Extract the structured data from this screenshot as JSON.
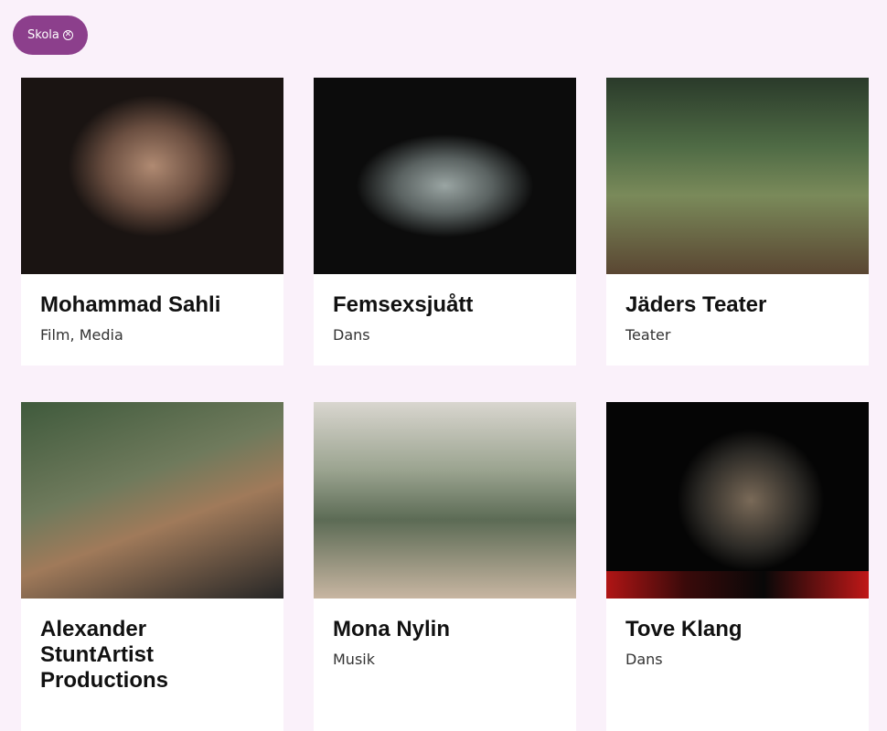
{
  "filter": {
    "label": "Skola",
    "remove_icon": "circle-x-icon"
  },
  "cards": [
    {
      "name": "Mohammad Sahli",
      "category": "Film, Media"
    },
    {
      "name": "Femsexsjuått",
      "category": "Dans"
    },
    {
      "name": "Jäders Teater",
      "category": "Teater"
    },
    {
      "name": "Alexander StuntArtist Productions",
      "category": ""
    },
    {
      "name": "Mona Nylin",
      "category": "Musik"
    },
    {
      "name": "Tove Klang",
      "category": "Dans"
    }
  ],
  "colors": {
    "background": "#faf1fa",
    "chip": "#8c3f8c",
    "card": "#ffffff"
  }
}
